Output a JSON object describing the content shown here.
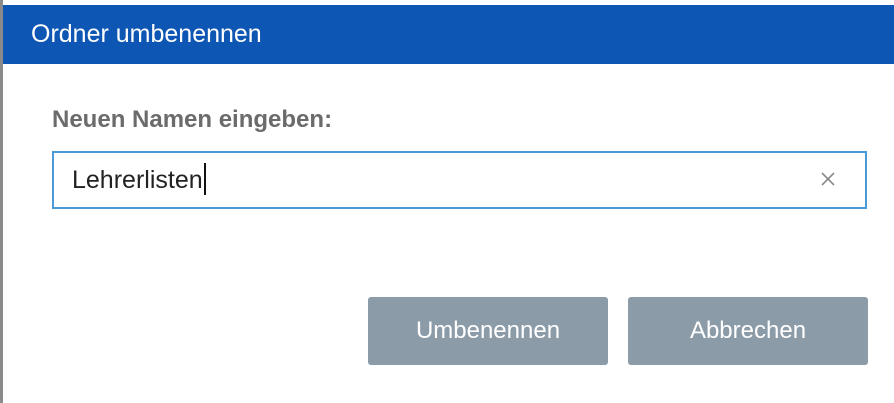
{
  "dialog": {
    "title": "Ordner umbenennen",
    "field_label": "Neuen Namen eingeben:",
    "input_value": "Lehrerlisten",
    "clear_icon": "close-icon",
    "rename_label": "Umbenennen",
    "cancel_label": "Abbrechen"
  },
  "colors": {
    "titlebar": "#0d56b3",
    "button": "#8c9ba8",
    "input_border": "#4a9ad6"
  }
}
